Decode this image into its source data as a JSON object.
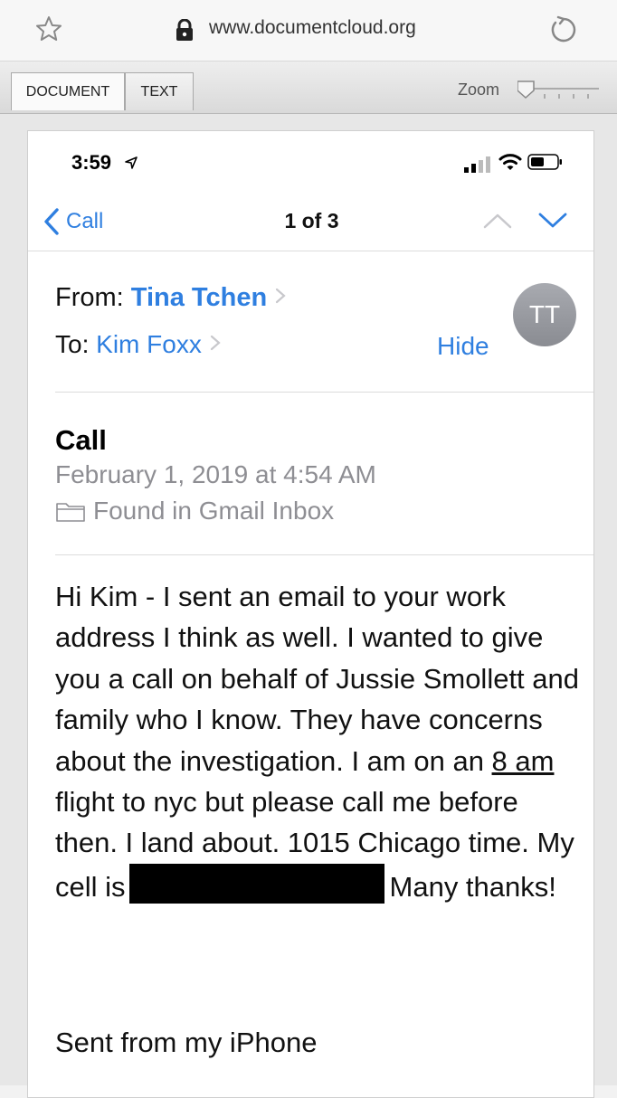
{
  "browser": {
    "url": "www.documentcloud.org",
    "icons": [
      "star-icon",
      "lock-icon",
      "reload-icon"
    ]
  },
  "viewer": {
    "tabs": [
      {
        "label": "DOCUMENT",
        "active": true
      },
      {
        "label": "TEXT",
        "active": false
      }
    ],
    "zoom_label": "Zoom"
  },
  "phone": {
    "status_time": "3:59",
    "nav": {
      "back_label": "Call",
      "position": "1 of 3"
    },
    "from_label": "From:",
    "from_name": "Tina Tchen",
    "to_label": "To:",
    "to_name": "Kim Foxx",
    "hide_label": "Hide",
    "avatar_initials": "TT",
    "subject": "Call",
    "date": "February 1, 2019 at 4:54 AM",
    "folder": "Found in Gmail Inbox",
    "body_before": "Hi Kim - I sent an email to your work address I think as well. I wanted to give you a call on behalf of Jussie Smollett and family who I know. They have concerns about the investigation. I am on an ",
    "body_underlined": "8 am",
    "body_middle": " flight to nyc but please call me before then. I land about. 1015 Chicago time. My cell is",
    "body_after": "Many thanks!",
    "signature": "Sent from my iPhone"
  },
  "colors": {
    "link_blue": "#2f7fe0",
    "gray_text": "#8e8e93"
  }
}
